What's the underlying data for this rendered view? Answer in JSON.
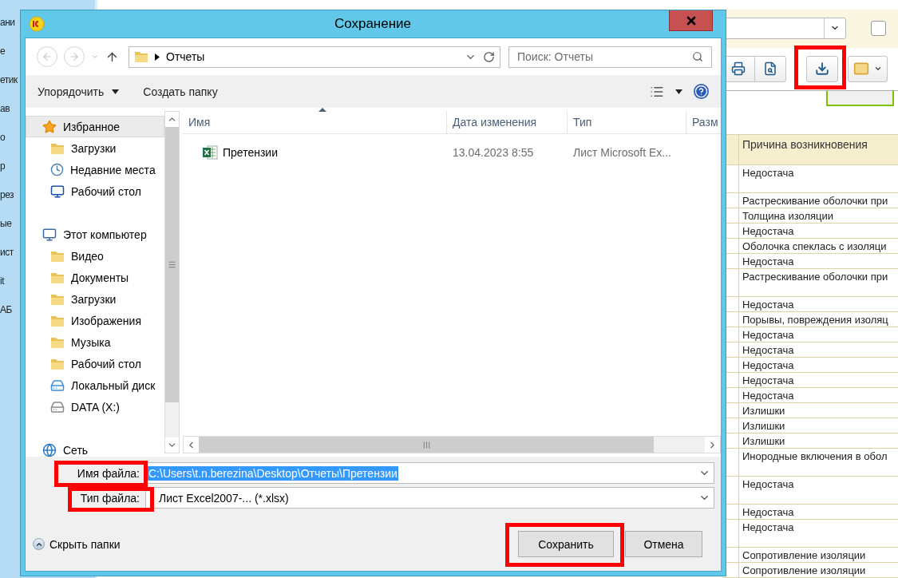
{
  "background_app": {
    "sidebar_fragments": [
      "ани",
      "е",
      "етик",
      "ав",
      "о",
      "р",
      "рез",
      "ые",
      "ист",
      "it",
      "АБ"
    ],
    "filter_bar": {
      "checkbox": {
        "checked": false
      }
    },
    "table": {
      "columns": [
        "Причина возникновения"
      ],
      "rows": [
        {
          "cause": "Недостача",
          "tall": true
        },
        {
          "cause": "Растрескивание оболочки при",
          "tall": false
        },
        {
          "cause": "Толщина изоляции",
          "tall": false
        },
        {
          "cause": "Недостача",
          "tall": false
        },
        {
          "cause": "Оболочка спеклась с изоляци",
          "tall": false
        },
        {
          "cause": "Недостача",
          "tall": false
        },
        {
          "cause": "Растрескивание оболочки при",
          "tall": true
        },
        {
          "cause": "Недостача",
          "tall": false
        },
        {
          "cause": "Порывы, повреждения изоляц",
          "tall": false
        },
        {
          "cause": "Недостача",
          "tall": false
        },
        {
          "cause": "Недостача",
          "tall": false
        },
        {
          "cause": "Недостача",
          "tall": false
        },
        {
          "cause": "Недостача",
          "tall": false
        },
        {
          "cause": "Недостача",
          "tall": false
        },
        {
          "cause": "Излишки",
          "tall": false
        },
        {
          "cause": "Излишки",
          "tall": false
        },
        {
          "cause": "Излишки",
          "tall": false
        },
        {
          "cause": "Инородные включения в обол",
          "tall": true
        },
        {
          "cause": "Недостача",
          "tall": true
        },
        {
          "cause": "Недостача",
          "tall": false
        },
        {
          "cause": "Недостача",
          "tall": true
        },
        {
          "cause": "Сопротивление изоляции",
          "tall": false
        },
        {
          "cause": "Сопротивление изоляции",
          "tall": false
        }
      ]
    }
  },
  "dialog": {
    "title": "Сохранение",
    "address": {
      "path": "Отчеты"
    },
    "search": {
      "placeholder": "Поиск: Отчеты"
    },
    "commands": [
      {
        "label": "Упорядочить",
        "has_menu": true
      },
      {
        "label": "Создать папку",
        "has_menu": false
      }
    ],
    "nav_tree": [
      {
        "label": "Избранное",
        "kind": "star",
        "selected": true,
        "children": [
          {
            "label": "Загрузки",
            "kind": "folder",
            "selected": false
          },
          {
            "label": "Недавние места",
            "kind": "recent",
            "selected": false
          },
          {
            "label": "Рабочий стол",
            "kind": "desktop",
            "selected": false
          }
        ]
      },
      {
        "label": "Этот компьютер",
        "kind": "computer",
        "selected": false,
        "children": [
          {
            "label": "Видео",
            "kind": "folder",
            "selected": false
          },
          {
            "label": "Документы",
            "kind": "folder",
            "selected": false
          },
          {
            "label": "Загрузки",
            "kind": "folder",
            "selected": false
          },
          {
            "label": "Изображения",
            "kind": "folder",
            "selected": false
          },
          {
            "label": "Музыка",
            "kind": "folder",
            "selected": false
          },
          {
            "label": "Рабочий стол",
            "kind": "folder",
            "selected": false
          },
          {
            "label": "Локальный диск",
            "kind": "drive",
            "selected": false
          },
          {
            "label": "DATA (X:)",
            "kind": "disk",
            "selected": false
          }
        ]
      },
      {
        "label": "Сеть",
        "kind": "network",
        "selected": false
      }
    ],
    "columns": [
      "Имя",
      "Дата изменения",
      "Тип",
      "Разм"
    ],
    "files": [
      {
        "name": "Претензии",
        "modified": "13.04.2023 8:55",
        "type": "Лист Microsoft Ex...",
        "selected": false
      }
    ],
    "file_name": {
      "label": "Имя файла:",
      "value": "C:\\Users\\t.n.berezina\\Desktop\\Отчеты\\Претензии",
      "text_selected": true
    },
    "file_type": {
      "label": "Тип файла:",
      "value": "Лист Excel2007-... (*.xlsx)"
    },
    "hide_folders": "Скрыть папки",
    "buttons": [
      "Сохранить",
      "Отмена"
    ]
  }
}
